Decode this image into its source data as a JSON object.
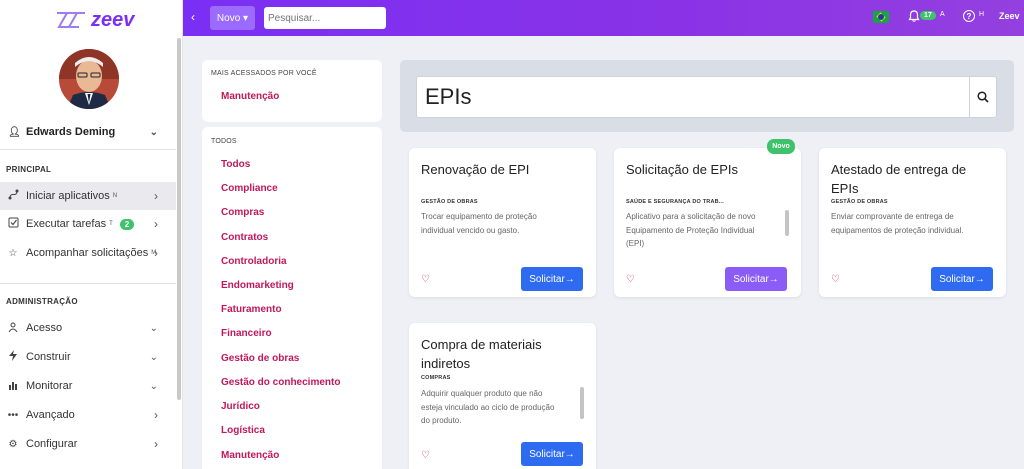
{
  "brand": {
    "logo_text": "zeev",
    "topbar_brand": "Zeev"
  },
  "user": {
    "name": "Edwards Deming"
  },
  "sidebar": {
    "principal_title": "PRINCIPAL",
    "principal_items": [
      {
        "label": "Iniciar aplicativos",
        "sup": "N"
      },
      {
        "label": "Executar tarefas",
        "sup": "T",
        "badge": "2"
      },
      {
        "label": "Acompanhar solicitações",
        "sup": "M"
      }
    ],
    "admin_title": "ADMINISTRAÇÃO",
    "admin_items": [
      {
        "label": "Acesso"
      },
      {
        "label": "Construir"
      },
      {
        "label": "Monitorar"
      },
      {
        "label": "Avançado"
      },
      {
        "label": "Configurar"
      }
    ]
  },
  "topbar": {
    "collapse": "‹",
    "novo_label": "Novo ▾",
    "search_placeholder": "Pesquisar...",
    "notif_count": "17",
    "notif_sup": "A",
    "help_icon": "?",
    "help_sup": "H"
  },
  "categories": {
    "most_accessed_title": "MAIS ACESSADOS POR VOCÊ",
    "most_accessed": [
      "Manutenção"
    ],
    "all_title": "TODOS",
    "all": [
      "Todos",
      "Compliance",
      "Compras",
      "Contratos",
      "Controladoria",
      "Endomarketing",
      "Faturamento",
      "Financeiro",
      "Gestão de obras",
      "Gestão do conhecimento",
      "Jurídico",
      "Logística",
      "Manutenção"
    ]
  },
  "search": {
    "value": "EPIs"
  },
  "cards": [
    {
      "title_l1": "Renovação de EPI",
      "title_l2": "",
      "category": "GESTÃO DE OBRAS",
      "desc_l1": "Trocar equipamento de proteção",
      "desc_l2": "individual vencido ou gasto.",
      "desc_l3": "",
      "button": "Solicitar→"
    },
    {
      "title_l1": "Solicitação de EPIs",
      "title_l2": "",
      "category": "SAÚDE E SEGURANÇA DO TRAB...",
      "desc_l1": "Aplicativo para a solicitação de novo",
      "desc_l2": "Equipamento de Proteção Individual",
      "desc_l3": "(EPI)",
      "button": "Solicitar→",
      "badge": "Novo"
    },
    {
      "title_l1": "Atestado de entrega de",
      "title_l2": "EPIs",
      "category": "GESTÃO DE OBRAS",
      "desc_l1": "Enviar comprovante de entrega de",
      "desc_l2": "equipamentos de proteção individual.",
      "desc_l3": "",
      "button": "Solicitar→"
    },
    {
      "title_l1": "Compra de materiais",
      "title_l2": "indiretos",
      "category": "COMPRAS",
      "desc_l1": "Adquirir qualquer produto que não",
      "desc_l2": "esteja vinculado ao ciclo de produção",
      "desc_l3": "do produto.",
      "button": "Solicitar→"
    }
  ],
  "colors": {
    "accent": "#7a2ff4",
    "link": "#c2185b",
    "button_blue": "#2f6bf0",
    "button_purple": "#8b5cf6",
    "badge_green": "#3ec26b"
  }
}
